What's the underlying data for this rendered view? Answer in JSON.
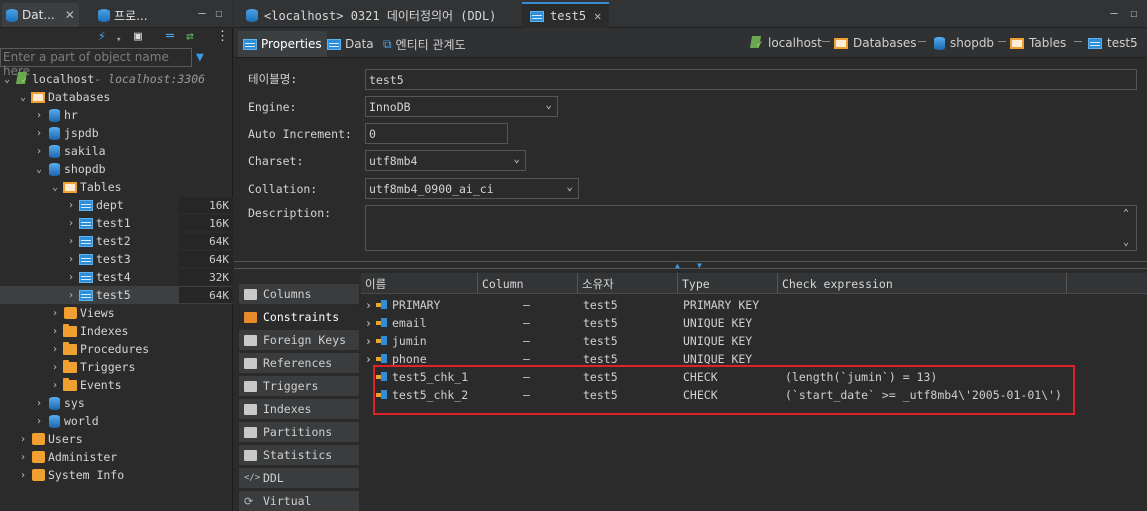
{
  "left_panel": {
    "tab1": "Dat...",
    "tab2": "프로...",
    "filter_placeholder": "Enter a part of object name here",
    "tree": {
      "server": "localhost",
      "server_detail": " - localhost:3306",
      "databases": "Databases",
      "dbs_top": [
        "hr",
        "jspdb",
        "sakila",
        "shopdb"
      ],
      "tables_label": "Tables",
      "tables": [
        {
          "name": "dept",
          "size": "16K"
        },
        {
          "name": "test1",
          "size": "16K"
        },
        {
          "name": "test2",
          "size": "64K"
        },
        {
          "name": "test3",
          "size": "64K"
        },
        {
          "name": "test4",
          "size": "32K"
        },
        {
          "name": "test5",
          "size": "64K"
        }
      ],
      "shop_folders": [
        "Views",
        "Indexes",
        "Procedures",
        "Triggers",
        "Events"
      ],
      "dbs_bottom": [
        "sys",
        "world"
      ],
      "server_items": [
        "Users",
        "Administer",
        "System Info"
      ]
    }
  },
  "editor": {
    "tab_ddl": "<localhost> 0321 데이터정의어 (DDL)",
    "tab_test5": "test5",
    "subtabs": [
      "Properties",
      "Data",
      "엔티티 관계도"
    ],
    "breadcrumb": [
      "localhost",
      "Databases",
      "shopdb",
      "Tables",
      "test5"
    ]
  },
  "properties": {
    "table_name_label": "테이블명:",
    "table_name": "test5",
    "engine_label": "Engine:",
    "engine": "InnoDB",
    "auto_inc_label": "Auto Increment:",
    "auto_inc": "0",
    "charset_label": "Charset:",
    "charset": "utf8mb4",
    "collation_label": "Collation:",
    "collation": "utf8mb4_0900_ai_ci",
    "description_label": "Description:"
  },
  "side_tabs": [
    "Columns",
    "Constraints",
    "Foreign Keys",
    "References",
    "Triggers",
    "Indexes",
    "Partitions",
    "Statistics",
    "DDL",
    "Virtual"
  ],
  "constraints": {
    "headers": [
      "이름",
      "Column",
      "소유자",
      "Type",
      "Check expression"
    ],
    "rows": [
      {
        "name": "PRIMARY",
        "column": "—",
        "owner": "test5",
        "type": "PRIMARY KEY",
        "expr": ""
      },
      {
        "name": "email",
        "column": "—",
        "owner": "test5",
        "type": "UNIQUE KEY",
        "expr": ""
      },
      {
        "name": "jumin",
        "column": "—",
        "owner": "test5",
        "type": "UNIQUE KEY",
        "expr": ""
      },
      {
        "name": "phone",
        "column": "—",
        "owner": "test5",
        "type": "UNIQUE KEY",
        "expr": ""
      },
      {
        "name": "test5_chk_1",
        "column": "—",
        "owner": "test5",
        "type": "CHECK",
        "expr": "(length(`jumin`) = 13)"
      },
      {
        "name": "test5_chk_2",
        "column": "—",
        "owner": "test5",
        "type": "CHECK",
        "expr": "(`start_date` >= _utf8mb4\\'2005-01-01\\')"
      }
    ]
  },
  "colors": {
    "highlight": "#e0212a",
    "accent": "#3a8bd0"
  }
}
